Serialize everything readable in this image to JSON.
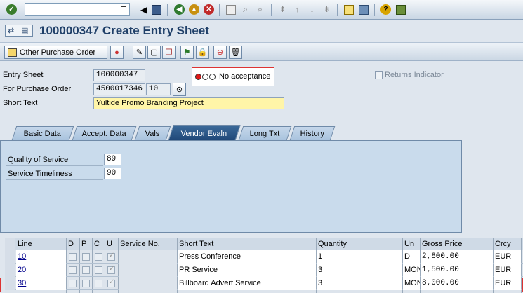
{
  "title": "100000347 Create Entry Sheet",
  "toolbar": {
    "other_po_label": "Other Purchase Order"
  },
  "header": {
    "entry_sheet_label": "Entry Sheet",
    "entry_sheet_value": "100000347",
    "po_label": "For Purchase Order",
    "po_value": "4500017346",
    "po_item": "10",
    "short_text_label": "Short Text",
    "short_text_value": "Yultide Promo Branding Project",
    "status_text": "No acceptance",
    "returns_label": "Returns Indicator"
  },
  "tabs": [
    {
      "label": "Basic Data"
    },
    {
      "label": "Accept. Data"
    },
    {
      "label": "Vals"
    },
    {
      "label": "Vendor Evaln"
    },
    {
      "label": "Long Txt"
    },
    {
      "label": "History"
    }
  ],
  "evaluation": {
    "quality_label": "Quality of Service",
    "quality_value": "89",
    "timeliness_label": "Service Timeliness",
    "timeliness_value": "90"
  },
  "table": {
    "headers": {
      "line": "Line",
      "d": "D",
      "p": "P",
      "c": "C",
      "u": "U",
      "service_no": "Service No.",
      "short_text": "Short Text",
      "quantity": "Quantity",
      "un": "Un",
      "gross_price": "Gross Price",
      "crcy": "Crcy"
    },
    "rows": [
      {
        "line": "10",
        "short_text": "Press Conference",
        "quantity": "1",
        "un": "D",
        "gross_price": "2,800.00",
        "crcy": "EUR"
      },
      {
        "line": "20",
        "short_text": "PR Service",
        "quantity": "3",
        "un": "MON",
        "gross_price": "1,500.00",
        "crcy": "EUR"
      },
      {
        "line": "30",
        "short_text": "Billboard Advert Service",
        "quantity": "3",
        "un": "MON",
        "gross_price": "8,000.00",
        "crcy": "EUR"
      }
    ]
  },
  "colors": {
    "title": "#1f3f68",
    "active_tab": "#1f4777",
    "highlight_border": "#dd3333",
    "short_text_bg": "#fff5a8"
  }
}
